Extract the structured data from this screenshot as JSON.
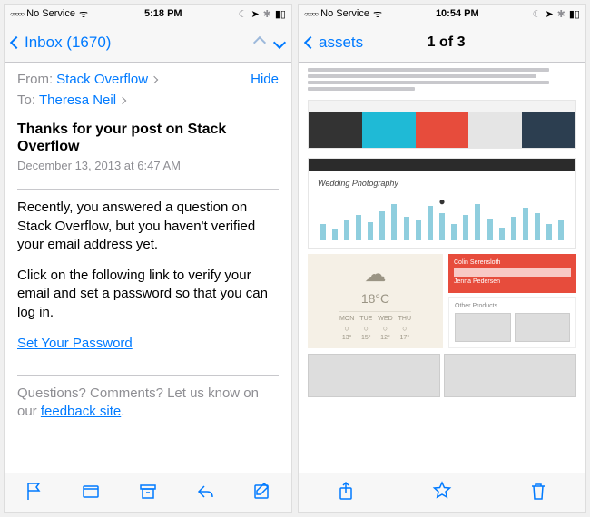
{
  "left": {
    "status": {
      "carrier": "No Service",
      "time": "5:18 PM"
    },
    "nav": {
      "back": "Inbox (1670)"
    },
    "from_label": "From:",
    "from_value": "Stack Overflow",
    "hide": "Hide",
    "to_label": "To:",
    "to_value": "Theresa Neil",
    "subject": "Thanks for your post on Stack Overflow",
    "date": "December 13, 2013 at 6:47 AM",
    "para1": "Recently, you answered a question on Stack Overflow, but you haven't verified your email address yet.",
    "para2": "Click on the following link to verify your email and set a password so that you can log in.",
    "cta": "Set Your Password",
    "footer_pre": "Questions? Comments? Let us know on our ",
    "footer_link": "feedback site",
    "footer_post": "."
  },
  "right": {
    "status": {
      "carrier": "No Service",
      "time": "10:54 PM"
    },
    "nav": {
      "back": "assets",
      "title": "1 of 3"
    },
    "swatches": [
      "#333333",
      "#1fbad6",
      "#e74c3c",
      "#e5e5e5",
      "#2c3e50"
    ],
    "chart_title": "Wedding Photography",
    "weather": {
      "temp": "18°C",
      "days": [
        "MON",
        "TUE",
        "WED",
        "THU"
      ],
      "temps": [
        "13°",
        "15°",
        "12°",
        "17°"
      ]
    },
    "contact1": "Colin Serensloth",
    "contact2": "Jenna Pedersen",
    "contact_section": "Other Products"
  }
}
